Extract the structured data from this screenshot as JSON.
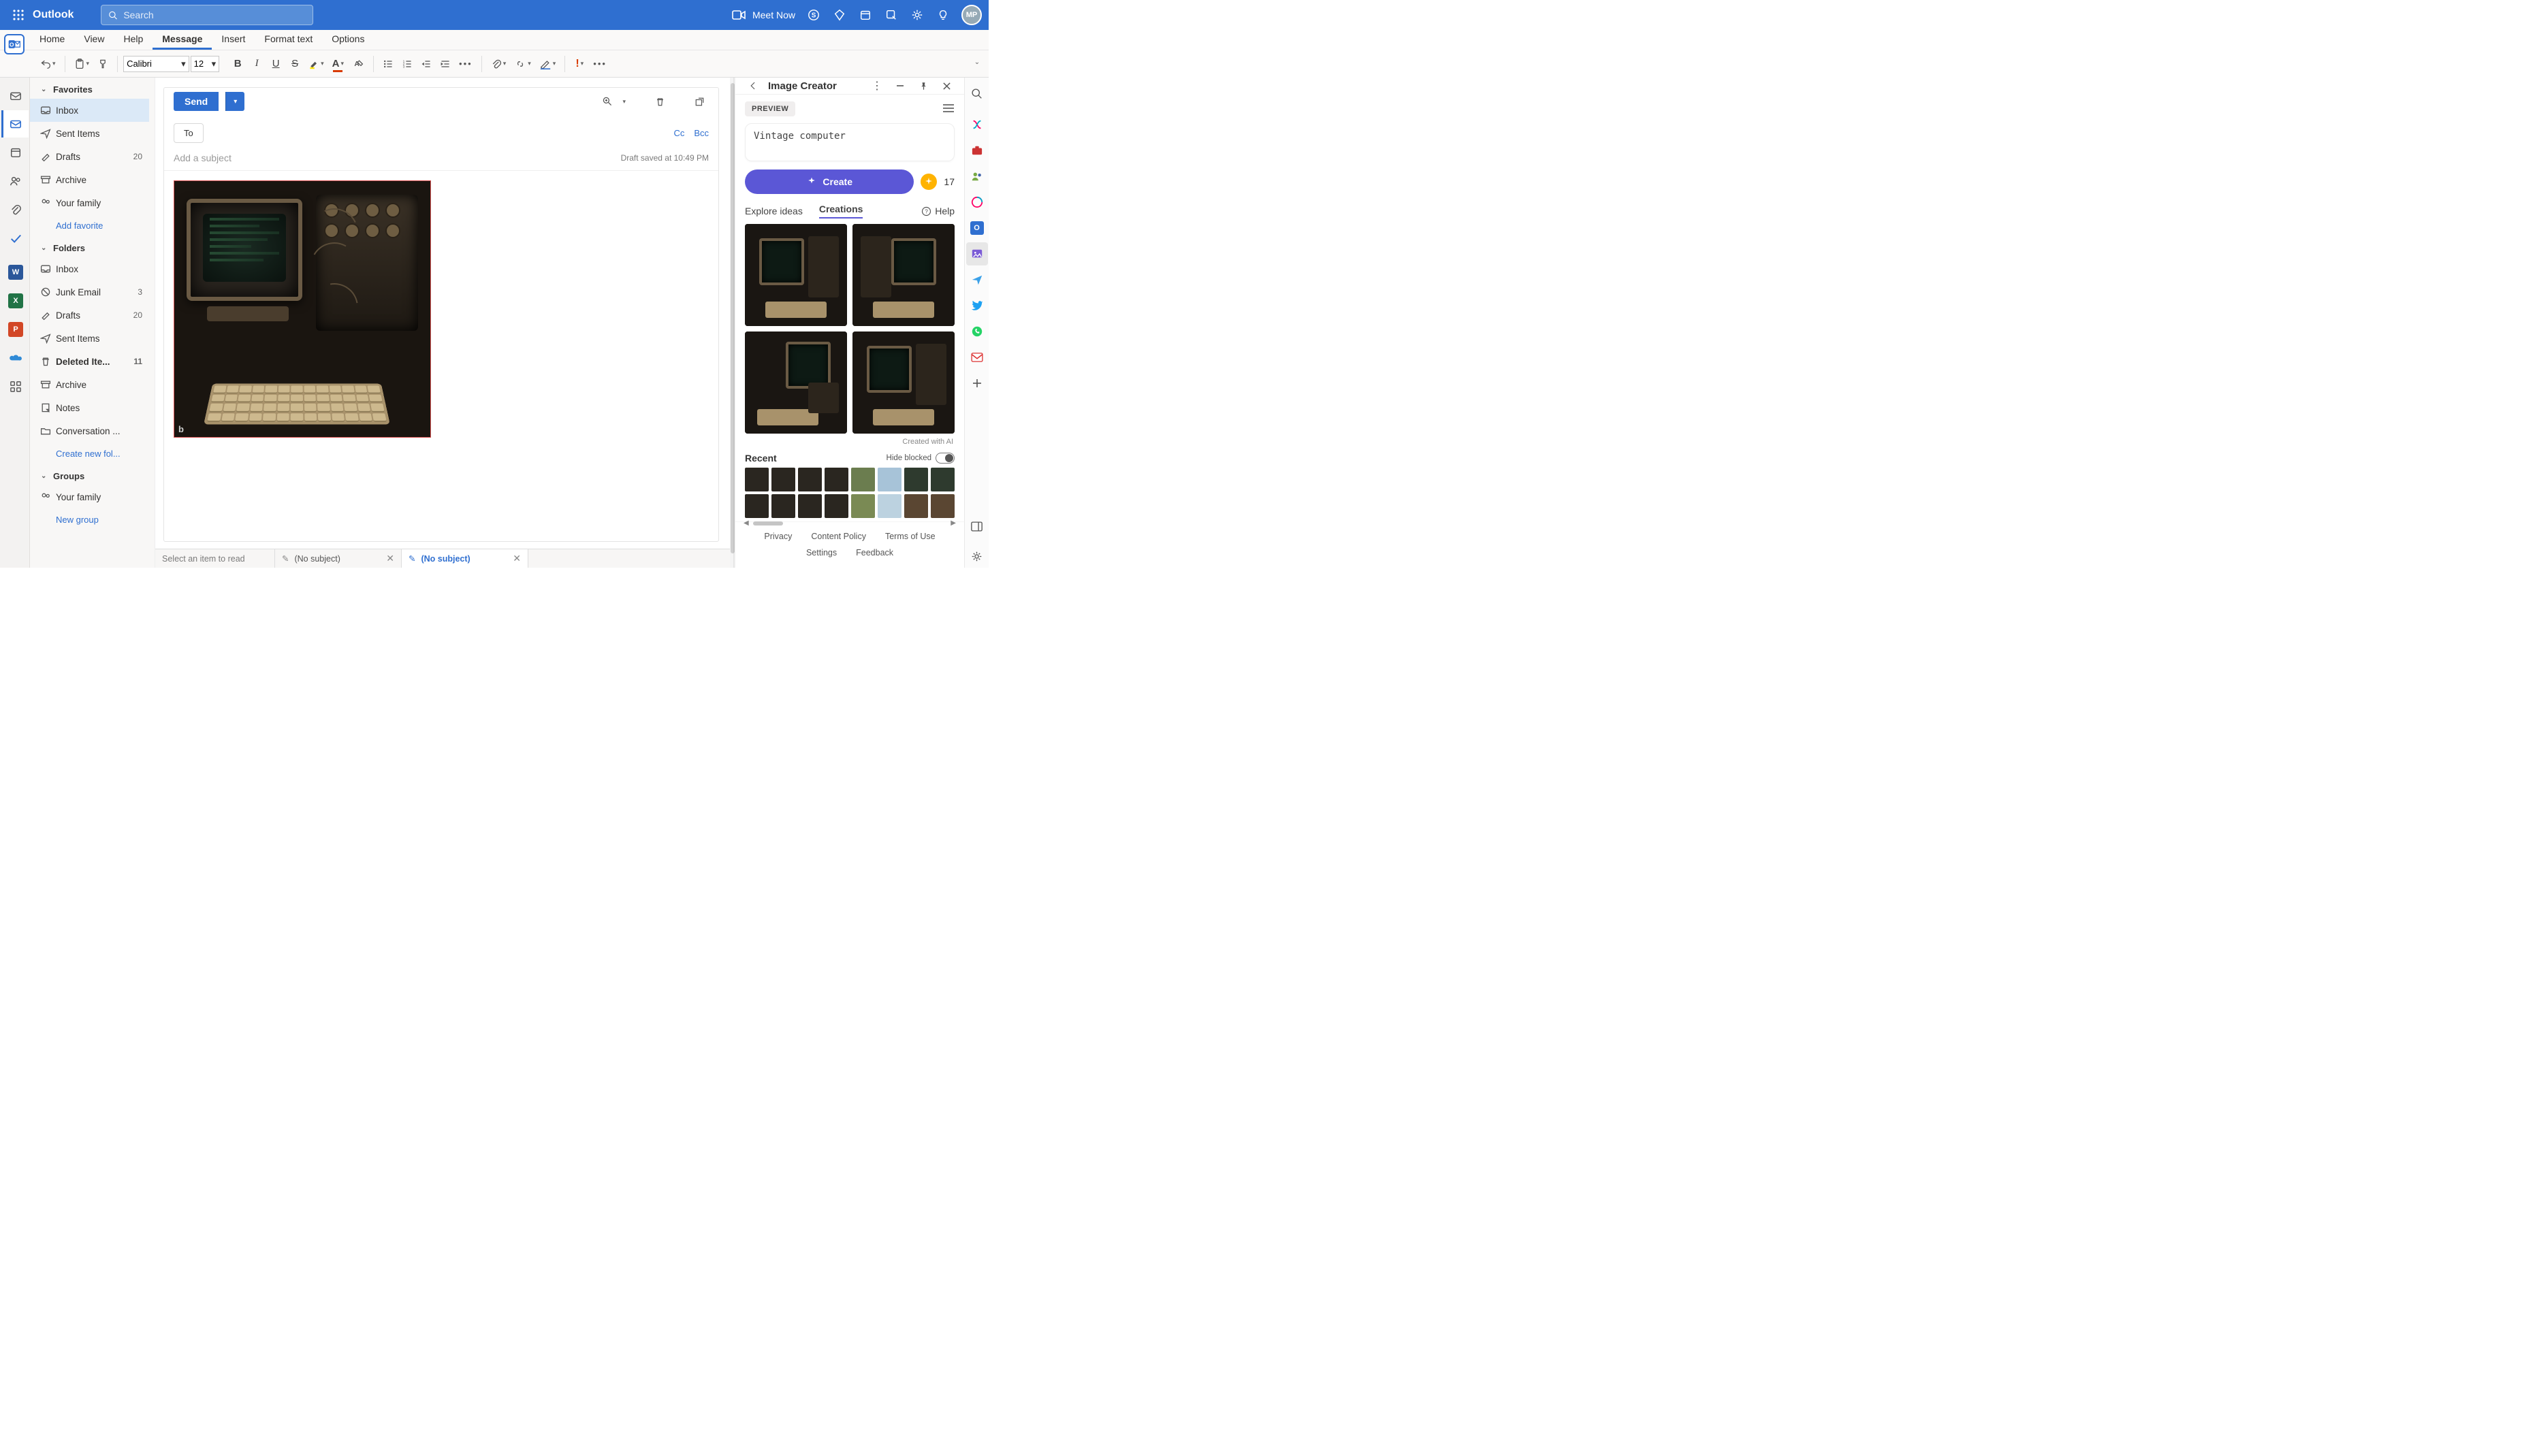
{
  "header": {
    "app_name": "Outlook",
    "search_placeholder": "Search",
    "meet_now": "Meet Now",
    "avatar_initials": "MP"
  },
  "ribbon": {
    "tabs": [
      "Home",
      "View",
      "Help",
      "Message",
      "Insert",
      "Format text",
      "Options"
    ],
    "active_index": 3,
    "font_name": "Calibri",
    "font_size": "12"
  },
  "nav": {
    "sections": {
      "favorites": "Favorites",
      "folders": "Folders",
      "groups": "Groups"
    },
    "favorites": [
      {
        "name": "Inbox",
        "icon": "inbox"
      },
      {
        "name": "Sent Items",
        "icon": "sent"
      },
      {
        "name": "Drafts",
        "icon": "draft",
        "count": "20"
      },
      {
        "name": "Archive",
        "icon": "archive"
      },
      {
        "name": "Your family",
        "icon": "people"
      }
    ],
    "add_favorite": "Add favorite",
    "folders_list": [
      {
        "name": "Inbox",
        "icon": "inbox"
      },
      {
        "name": "Junk Email",
        "icon": "junk",
        "count": "3"
      },
      {
        "name": "Drafts",
        "icon": "draft",
        "count": "20"
      },
      {
        "name": "Sent Items",
        "icon": "sent"
      },
      {
        "name": "Deleted Ite...",
        "icon": "trash",
        "count": "11",
        "bold": true
      },
      {
        "name": "Archive",
        "icon": "archive"
      },
      {
        "name": "Notes",
        "icon": "note"
      },
      {
        "name": "Conversation ...",
        "icon": "folder"
      }
    ],
    "create_folder": "Create new fol...",
    "groups_list": [
      {
        "name": "Your family",
        "icon": "people"
      }
    ],
    "new_group": "New group"
  },
  "compose": {
    "send": "Send",
    "to_label": "To",
    "cc": "Cc",
    "bcc": "Bcc",
    "subject_placeholder": "Add a subject",
    "draft_saved": "Draft saved at 10:49 PM"
  },
  "doctabs": {
    "hint": "Select an item to read",
    "tab1": "(No subject)",
    "tab2": "(No subject)"
  },
  "panel": {
    "title": "Image Creator",
    "preview_badge": "PREVIEW",
    "prompt": "Vintage computer",
    "create": "Create",
    "credits": "17",
    "tab_explore": "Explore ideas",
    "tab_creations": "Creations",
    "help": "Help",
    "created_with": "Created with AI",
    "recent": "Recent",
    "hide_blocked": "Hide blocked",
    "footer": {
      "privacy": "Privacy",
      "policy": "Content Policy",
      "terms": "Terms of Use",
      "settings": "Settings",
      "feedback": "Feedback"
    }
  }
}
